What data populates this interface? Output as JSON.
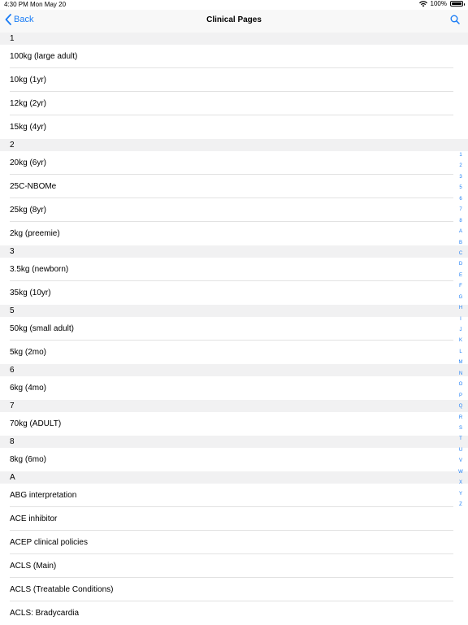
{
  "status_bar": {
    "time": "4:30 PM",
    "date": "Mon May 20",
    "battery": "100%"
  },
  "nav": {
    "back_label": "Back",
    "title": "Clinical Pages"
  },
  "sections": [
    {
      "header": "1",
      "items": [
        "100kg (large adult)",
        "10kg (1yr)",
        "12kg (2yr)",
        "15kg (4yr)"
      ]
    },
    {
      "header": "2",
      "items": [
        "20kg (6yr)",
        "25C-NBOMe",
        "25kg (8yr)",
        "2kg (preemie)"
      ]
    },
    {
      "header": "3",
      "items": [
        "3.5kg (newborn)",
        "35kg (10yr)"
      ]
    },
    {
      "header": "5",
      "items": [
        "50kg (small adult)",
        "5kg (2mo)"
      ]
    },
    {
      "header": "6",
      "items": [
        "6kg (4mo)"
      ]
    },
    {
      "header": "7",
      "items": [
        "70kg (ADULT)"
      ]
    },
    {
      "header": "8",
      "items": [
        "8kg (6mo)"
      ]
    },
    {
      "header": "A",
      "items": [
        "ABG interpretation",
        "ACE inhibitor",
        "ACEP clinical policies",
        "ACLS (Main)",
        "ACLS (Treatable Conditions)",
        "ACLS: Bradycardia"
      ]
    }
  ],
  "index_letters": [
    "1",
    "2",
    "3",
    "5",
    "6",
    "7",
    "8",
    "A",
    "B",
    "C",
    "D",
    "E",
    "F",
    "G",
    "H",
    "I",
    "J",
    "K",
    "L",
    "M",
    "N",
    "O",
    "P",
    "Q",
    "R",
    "S",
    "T",
    "U",
    "V",
    "W",
    "X",
    "Y",
    "Z"
  ],
  "colors": {
    "accent": "#1a7cf5",
    "section_bg": "#f1f1f2"
  }
}
